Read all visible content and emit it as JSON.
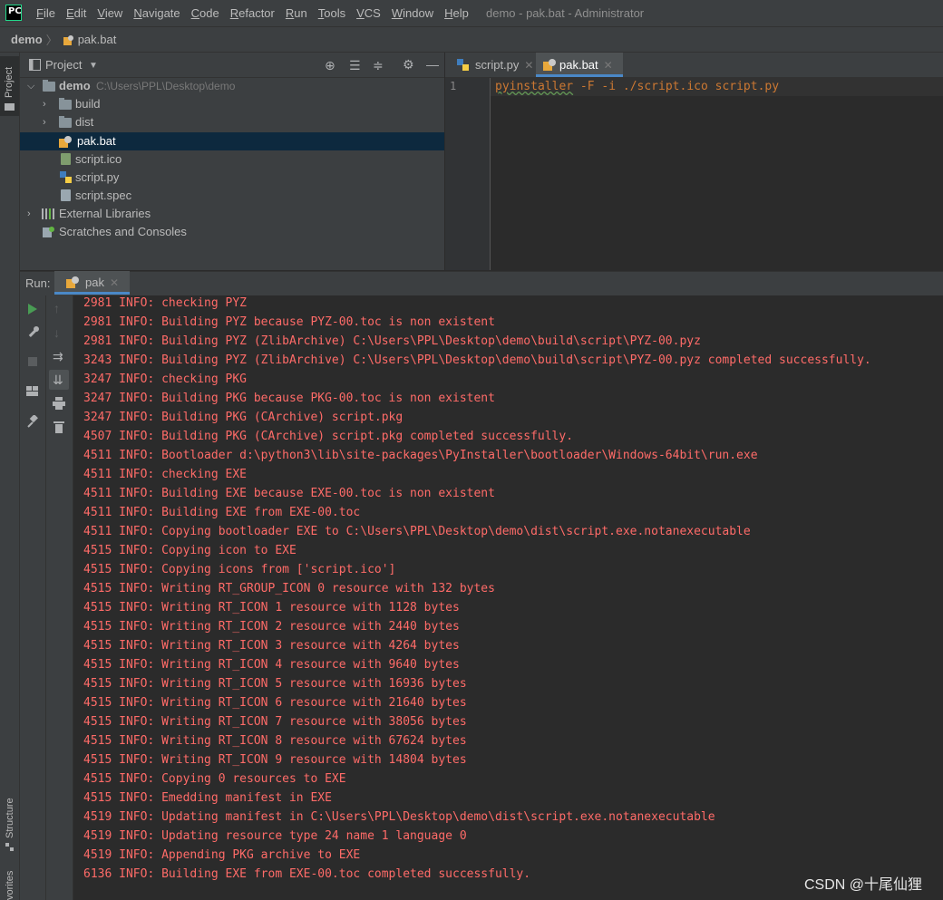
{
  "app": {
    "logo_text": "PC",
    "menu": [
      "File",
      "Edit",
      "View",
      "Navigate",
      "Code",
      "Refactor",
      "Run",
      "Tools",
      "VCS",
      "Window",
      "Help"
    ],
    "window_title": "demo - pak.bat - Administrator"
  },
  "breadcrumb": {
    "project": "demo",
    "separator": "〉",
    "file": "pak.bat"
  },
  "left_strip": {
    "top": "Project",
    "bottom1": "Structure",
    "bottom2": "vorites"
  },
  "project_panel": {
    "title": "Project",
    "tree": [
      {
        "label": "demo",
        "hint": "C:\\Users\\PPL\\Desktop\\demo",
        "icon": "folder-icon"
      },
      {
        "label": "build",
        "icon": "folder-icon"
      },
      {
        "label": "dist",
        "icon": "folder-icon"
      },
      {
        "label": "pak.bat",
        "icon": "bat-file-icon"
      },
      {
        "label": "script.ico",
        "icon": "image-file-icon"
      },
      {
        "label": "script.py",
        "icon": "python-file-icon"
      },
      {
        "label": "script.spec",
        "icon": "text-file-icon"
      },
      {
        "label": "External Libraries",
        "icon": "library-icon"
      },
      {
        "label": "Scratches and Consoles",
        "icon": "scratches-icon"
      }
    ]
  },
  "editor": {
    "tabs": [
      {
        "label": "script.py",
        "icon": "python-file-icon"
      },
      {
        "label": "pak.bat",
        "icon": "bat-file-icon"
      }
    ],
    "line_number": "1",
    "code_squiggle": "pyinstaller",
    "code_rest": " -F -i ./script.ico script.py"
  },
  "run": {
    "label": "Run:",
    "tab": "pak",
    "console": [
      "2981 INFO: checking PYZ",
      "2981 INFO: Building PYZ because PYZ-00.toc is non existent",
      "2981 INFO: Building PYZ (ZlibArchive) C:\\Users\\PPL\\Desktop\\demo\\build\\script\\PYZ-00.pyz",
      "3243 INFO: Building PYZ (ZlibArchive) C:\\Users\\PPL\\Desktop\\demo\\build\\script\\PYZ-00.pyz completed successfully.",
      "3247 INFO: checking PKG",
      "3247 INFO: Building PKG because PKG-00.toc is non existent",
      "3247 INFO: Building PKG (CArchive) script.pkg",
      "4507 INFO: Building PKG (CArchive) script.pkg completed successfully.",
      "4511 INFO: Bootloader d:\\python3\\lib\\site-packages\\PyInstaller\\bootloader\\Windows-64bit\\run.exe",
      "4511 INFO: checking EXE",
      "4511 INFO: Building EXE because EXE-00.toc is non existent",
      "4511 INFO: Building EXE from EXE-00.toc",
      "4511 INFO: Copying bootloader EXE to C:\\Users\\PPL\\Desktop\\demo\\dist\\script.exe.notanexecutable",
      "4515 INFO: Copying icon to EXE",
      "4515 INFO: Copying icons from ['script.ico']",
      "4515 INFO: Writing RT_GROUP_ICON 0 resource with 132 bytes",
      "4515 INFO: Writing RT_ICON 1 resource with 1128 bytes",
      "4515 INFO: Writing RT_ICON 2 resource with 2440 bytes",
      "4515 INFO: Writing RT_ICON 3 resource with 4264 bytes",
      "4515 INFO: Writing RT_ICON 4 resource with 9640 bytes",
      "4515 INFO: Writing RT_ICON 5 resource with 16936 bytes",
      "4515 INFO: Writing RT_ICON 6 resource with 21640 bytes",
      "4515 INFO: Writing RT_ICON 7 resource with 38056 bytes",
      "4515 INFO: Writing RT_ICON 8 resource with 67624 bytes",
      "4515 INFO: Writing RT_ICON 9 resource with 14804 bytes",
      "4515 INFO: Copying 0 resources to EXE",
      "4515 INFO: Emedding manifest in EXE",
      "4519 INFO: Updating manifest in C:\\Users\\PPL\\Desktop\\demo\\dist\\script.exe.notanexecutable",
      "4519 INFO: Updating resource type 24 name 1 language 0",
      "4519 INFO: Appending PKG archive to EXE",
      "6136 INFO: Building EXE from EXE-00.toc completed successfully."
    ]
  },
  "watermark": "CSDN @十尾仙狸",
  "colors": {
    "console_error": "#ff6b68",
    "selection": "#0d293e",
    "accent": "#4a88c7"
  }
}
